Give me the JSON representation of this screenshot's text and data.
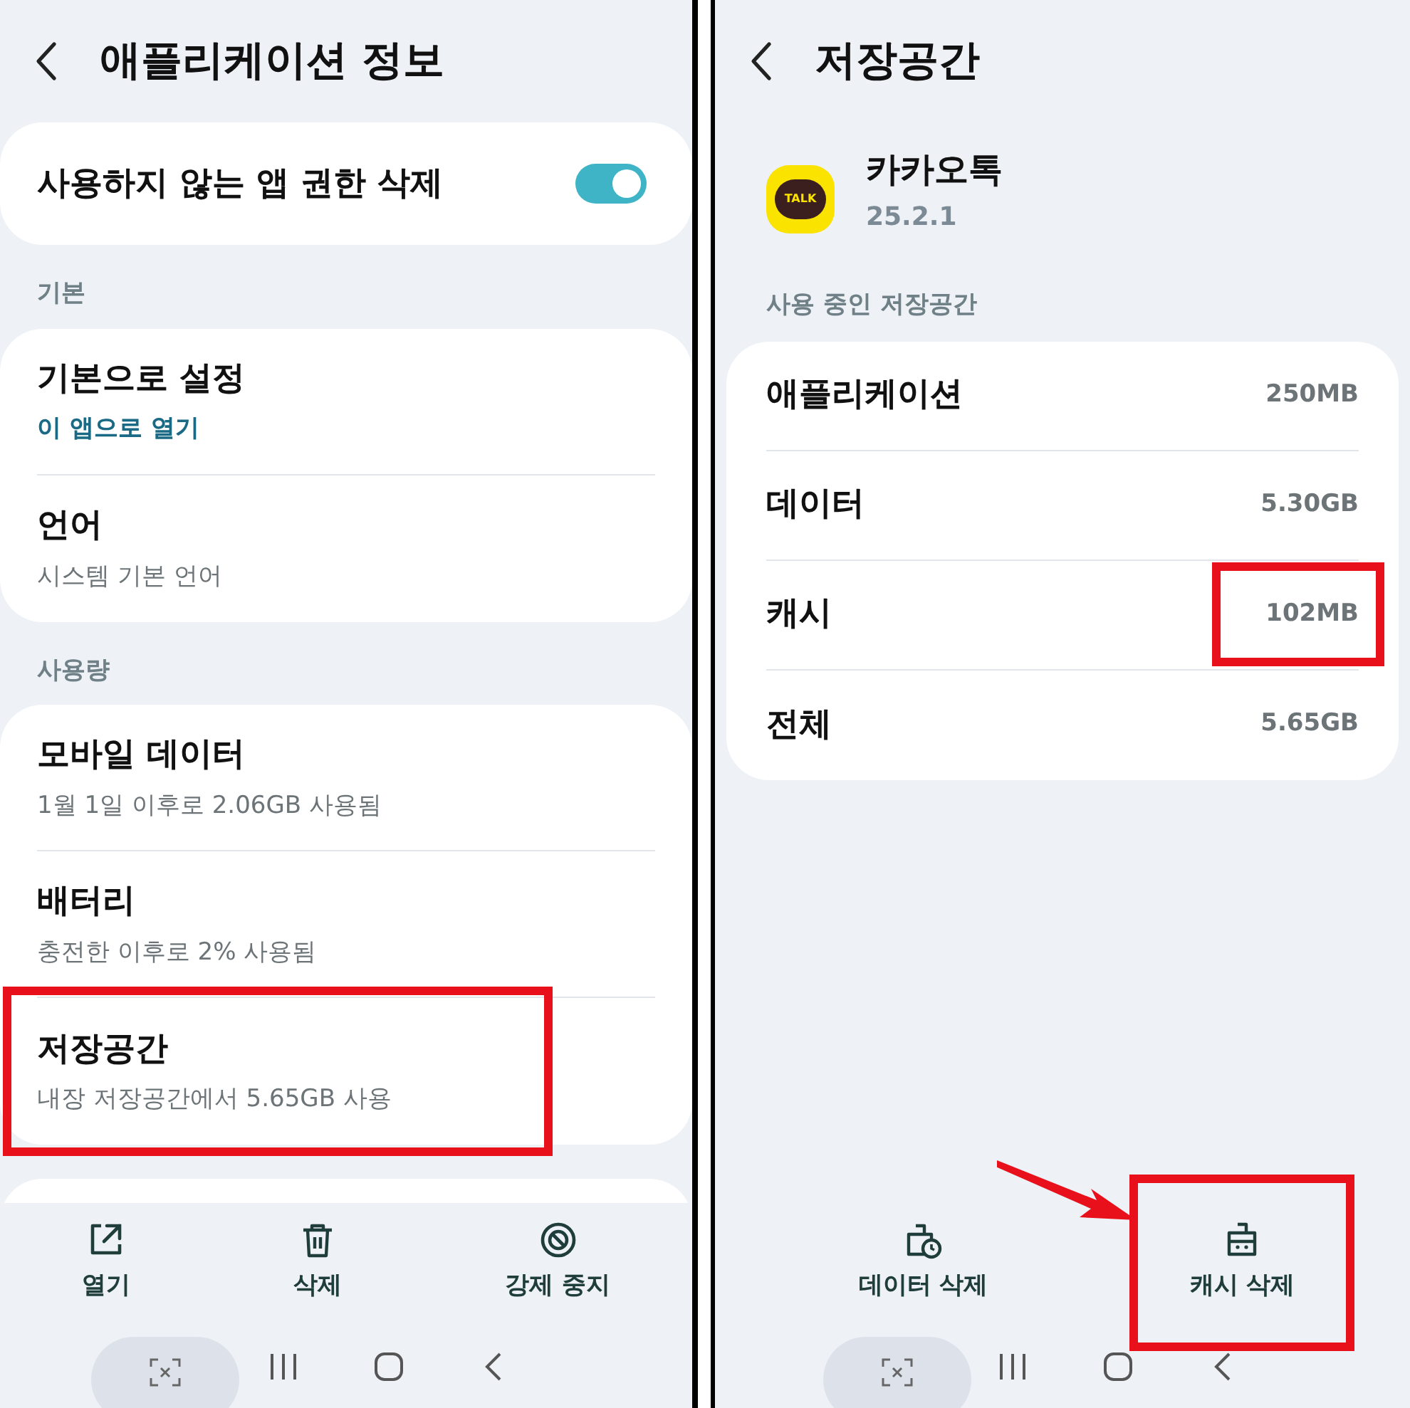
{
  "left": {
    "title": "애플리케이션 정보",
    "top_card": {
      "label": "사용하지 않는 앱 권한 삭제",
      "on": true
    },
    "sections": [
      {
        "header": "기본",
        "items": [
          {
            "title": "기본으로 설정",
            "subtitle": "이 앱으로 열기",
            "kind": "link",
            "highlighted": false
          },
          {
            "title": "언어",
            "subtitle": "시스템 기본 언어",
            "kind": "plain",
            "highlighted": false
          }
        ]
      },
      {
        "header": "사용량",
        "items": [
          {
            "title": "모바일 데이터",
            "subtitle": "1월 1일 이후로 2.06GB 사용됨",
            "kind": "plain",
            "highlighted": false
          },
          {
            "title": "배터리",
            "subtitle": "충전한 이후로 2% 사용됨",
            "kind": "plain",
            "highlighted": false
          },
          {
            "title": "저장공간",
            "subtitle": "내장 저장공간에서 5.65GB 사용",
            "kind": "plain",
            "highlighted": true
          }
        ]
      }
    ],
    "actions": [
      {
        "label": "열기",
        "kind": "open"
      },
      {
        "label": "삭제",
        "kind": "delete"
      },
      {
        "label": "강제 중지",
        "kind": "stop"
      }
    ]
  },
  "right": {
    "title": "저장공간",
    "app": {
      "name": "카카오톡",
      "version": "25.2.1",
      "icon_text": "TALK"
    },
    "section": "사용 중인 저장공간",
    "rows": [
      {
        "label": "애플리케이션",
        "value": "250MB",
        "highlighted": false
      },
      {
        "label": "데이터",
        "value": "5.30GB",
        "highlighted": false
      },
      {
        "label": "캐시",
        "value": "102MB",
        "highlighted": true
      },
      {
        "label": "전체",
        "value": "5.65GB",
        "highlighted": false
      }
    ],
    "actions": [
      {
        "label": "데이터 삭제",
        "kind": "clear-data",
        "highlighted": false
      },
      {
        "label": "캐시 삭제",
        "kind": "clear-cache",
        "highlighted": true
      }
    ],
    "arrow": true
  }
}
